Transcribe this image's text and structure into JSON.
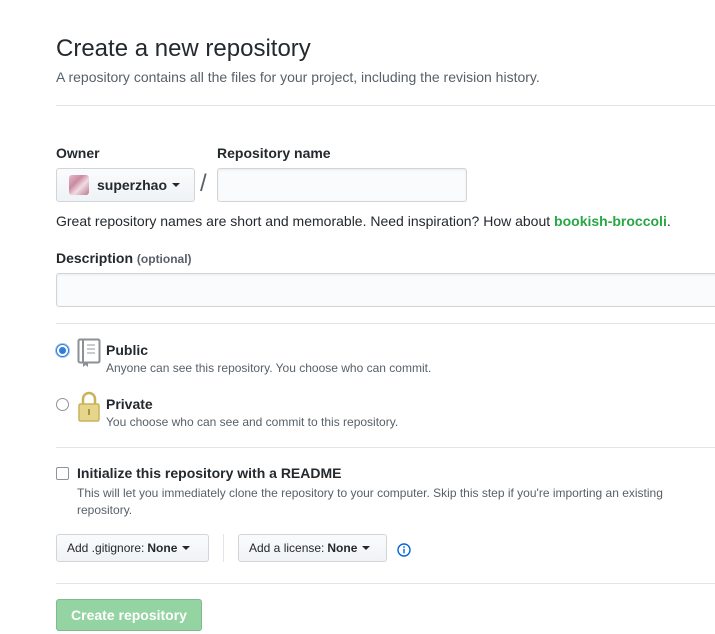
{
  "header": {
    "title": "Create a new repository",
    "subtitle": "A repository contains all the files for your project, including the revision history."
  },
  "owner": {
    "label": "Owner",
    "value": "superzhao",
    "icon": "avatar"
  },
  "separator": "/",
  "repo_name": {
    "label": "Repository name",
    "value": "",
    "placeholder": ""
  },
  "hint": {
    "text": "Great repository names are short and memorable. Need inspiration? How about ",
    "suggestion": "bookish-broccoli",
    "suffix": "."
  },
  "description": {
    "label": "Description",
    "optional": "(optional)",
    "value": "",
    "placeholder": ""
  },
  "visibility": {
    "selected": "public",
    "options": [
      {
        "id": "public",
        "title": "Public",
        "desc": "Anyone can see this repository. You choose who can commit.",
        "icon": "repo-book-icon"
      },
      {
        "id": "private",
        "title": "Private",
        "desc": "You choose who can see and commit to this repository.",
        "icon": "lock-icon"
      }
    ]
  },
  "readme": {
    "checked": false,
    "label": "Initialize this repository with a README",
    "desc_line1": "This will let you immediately clone the repository to your computer. Skip this step if you're importing an existing",
    "desc_line2": "repository."
  },
  "gitignore": {
    "label": "Add .gitignore:",
    "value": "None"
  },
  "license": {
    "label": "Add a license:",
    "value": "None"
  },
  "info_icon": "info-icon",
  "submit": {
    "label": "Create repository",
    "disabled": true
  },
  "colors": {
    "accent_blue": "#2f7ed8",
    "suggestion_green": "#28a745",
    "submit_disabled_green": "#94d3a2",
    "border": "#d1d5da"
  }
}
